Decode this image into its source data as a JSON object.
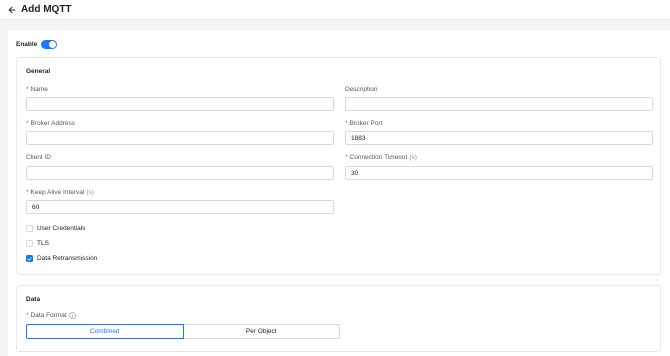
{
  "header": {
    "title": "Add MQTT"
  },
  "enable": {
    "label": "Enable",
    "on": true
  },
  "general": {
    "title": "General",
    "name": {
      "label": "Name",
      "required": true,
      "value": ""
    },
    "description": {
      "label": "Description",
      "required": false,
      "value": ""
    },
    "broker_address": {
      "label": "Broker Address",
      "required": true,
      "value": ""
    },
    "broker_port": {
      "label": "Broker Port",
      "required": true,
      "value": "1883"
    },
    "client_id": {
      "label": "Client ID",
      "required": false,
      "value": ""
    },
    "connection_timeout": {
      "label": "Connection Timeout",
      "unit": "(s)",
      "required": true,
      "value": "30"
    },
    "keep_alive": {
      "label": "Keep Alive Interval",
      "unit": "(s)",
      "required": true,
      "value": "60"
    },
    "checkboxes": [
      {
        "label": "User Credentials",
        "checked": false
      },
      {
        "label": "TLS",
        "checked": false
      },
      {
        "label": "Data Retransmission",
        "checked": true
      }
    ]
  },
  "data": {
    "title": "Data",
    "data_format": {
      "label": "Data Format",
      "required": true,
      "icon": "info-icon"
    },
    "options": [
      {
        "label": "Combined",
        "selected": true
      },
      {
        "label": "Per Object",
        "selected": false
      }
    ]
  },
  "colors": {
    "accent": "#1677ff",
    "required": "#ff4d4f"
  }
}
